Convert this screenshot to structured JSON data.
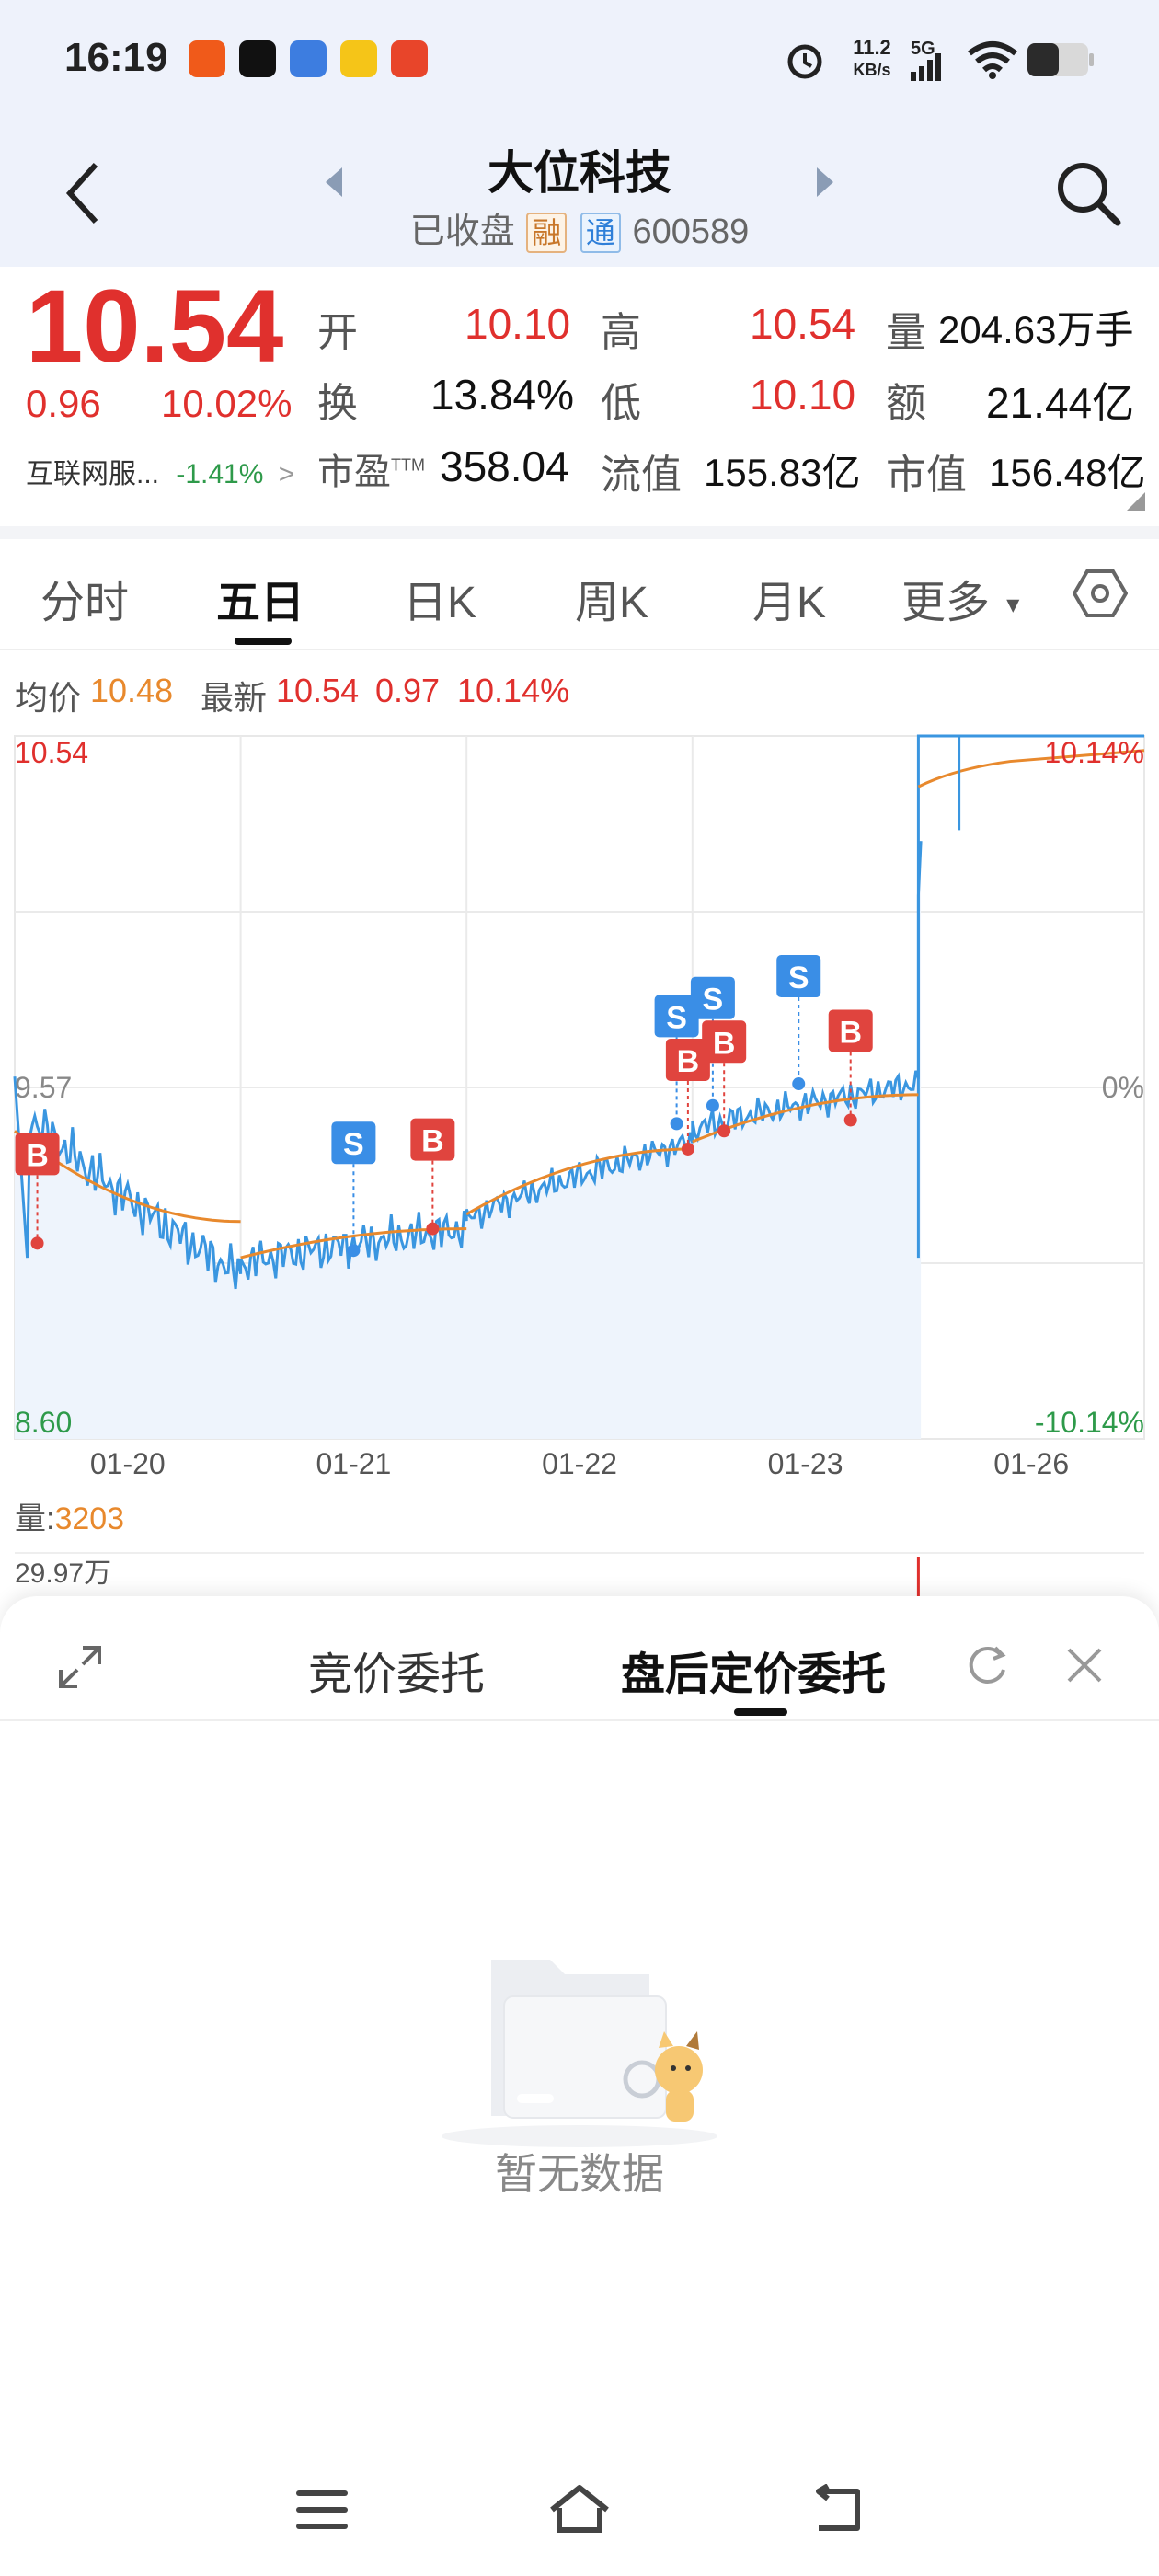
{
  "status_bar": {
    "time": "16:19",
    "network_speed": "11.2",
    "network_unit": "KB/s",
    "signal": "5G",
    "icons": [
      "alarm-icon",
      "signal-icon",
      "wifi-icon",
      "battery-icon"
    ]
  },
  "header": {
    "title": "大位科技",
    "status": "已收盘",
    "tag1": "融",
    "tag2": "通",
    "code": "600589"
  },
  "quote": {
    "price": "10.54",
    "change": "0.96",
    "change_pct": "10.02%",
    "sector": "互联网服...",
    "sector_change": "-1.41%",
    "open_label": "开",
    "open": "10.10",
    "high_label": "高",
    "high": "10.54",
    "volume_label": "量",
    "volume": "204.63万手",
    "turnover_label": "换",
    "turnover": "13.84%",
    "low_label": "低",
    "low": "10.10",
    "amount_label": "额",
    "amount": "21.44亿",
    "pe_label": "市盈",
    "pe_sup": "TTM",
    "pe": "358.04",
    "float_cap_label": "流值",
    "float_cap": "155.83亿",
    "market_cap_label": "市值",
    "market_cap": "156.48亿"
  },
  "tabs": {
    "items": [
      "分时",
      "五日",
      "日K",
      "周K",
      "月K",
      "更多"
    ],
    "active": "五日"
  },
  "chart_header": {
    "avg_label": "均价",
    "avg": "10.48",
    "latest_label": "最新",
    "latest": "10.54",
    "latest_change": "0.97",
    "latest_pct": "10.14%"
  },
  "chart_data": {
    "type": "line",
    "y_top": "10.54",
    "y_mid": "9.57",
    "y_bottom": "8.60",
    "pct_top": "10.14%",
    "pct_mid": "0%",
    "pct_bottom": "-10.14%",
    "x_labels": [
      "01-20",
      "01-21",
      "01-22",
      "01-23",
      "01-26"
    ],
    "ylim": [
      8.6,
      10.54
    ],
    "prev_close": 9.57,
    "series": [],
    "markers": [
      {
        "label": "B",
        "day": 0,
        "pos": 0.1,
        "price": 9.14
      },
      {
        "label": "S",
        "day": 1,
        "pos": 0.5,
        "price": 9.12
      },
      {
        "label": "B",
        "day": 1,
        "pos": 0.85,
        "price": 9.18
      },
      {
        "label": "S",
        "day": 2,
        "pos": 0.93,
        "price": 9.47
      },
      {
        "label": "B",
        "day": 2,
        "pos": 0.98,
        "price": 9.4
      },
      {
        "label": "S",
        "day": 3,
        "pos": 0.09,
        "price": 9.52
      },
      {
        "label": "B",
        "day": 3,
        "pos": 0.14,
        "price": 9.45
      },
      {
        "label": "S",
        "day": 3,
        "pos": 0.47,
        "price": 9.58
      },
      {
        "label": "B",
        "day": 3,
        "pos": 0.7,
        "price": 9.48
      }
    ],
    "volume_label": "量:",
    "volume_value": "3203",
    "volume_top": "29.97万"
  },
  "panel": {
    "tab1": "竞价委托",
    "tab2": "盘后定价委托",
    "empty_text": "暂无数据"
  }
}
